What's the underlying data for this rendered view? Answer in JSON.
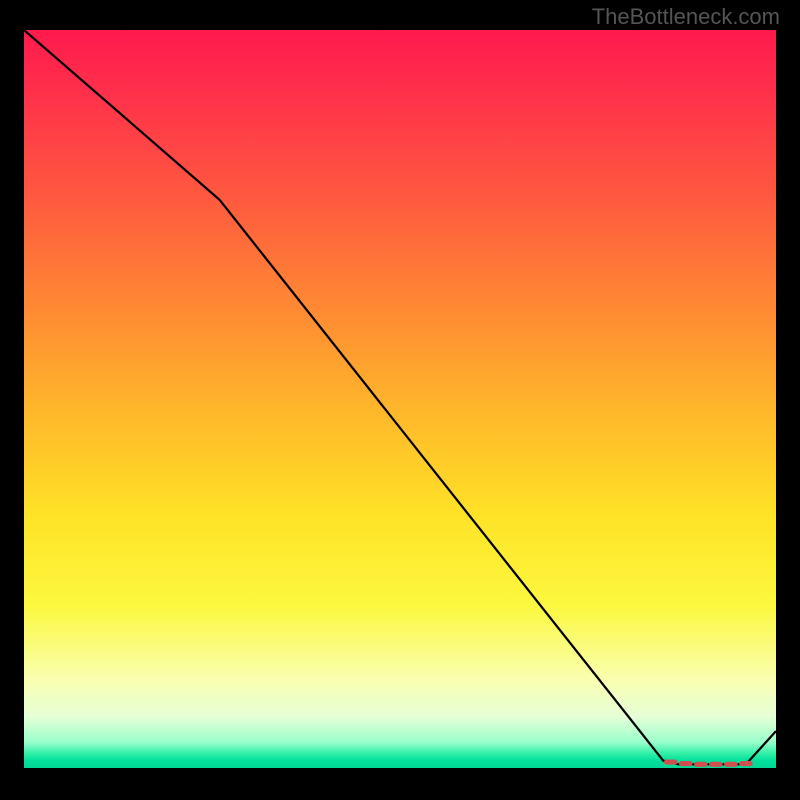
{
  "watermark": "TheBottleneck.com",
  "chart_data": {
    "type": "line",
    "title": "",
    "xlabel": "",
    "ylabel": "",
    "xlim": [
      0,
      100
    ],
    "ylim": [
      0,
      100
    ],
    "grid": false,
    "legend": false,
    "series": [
      {
        "name": "line",
        "color": "#000000",
        "x": [
          0,
          26,
          85,
          87,
          96,
          100
        ],
        "y": [
          100,
          77,
          1,
          0.5,
          0.5,
          5
        ]
      }
    ],
    "markers": {
      "name": "bottom-dashes",
      "color": "#d05050",
      "shape": "dash",
      "x": [
        86,
        88,
        90,
        92,
        94,
        96
      ],
      "y": [
        0.8,
        0.6,
        0.5,
        0.5,
        0.5,
        0.6
      ]
    },
    "background": "heat-gradient-red-to-green"
  }
}
